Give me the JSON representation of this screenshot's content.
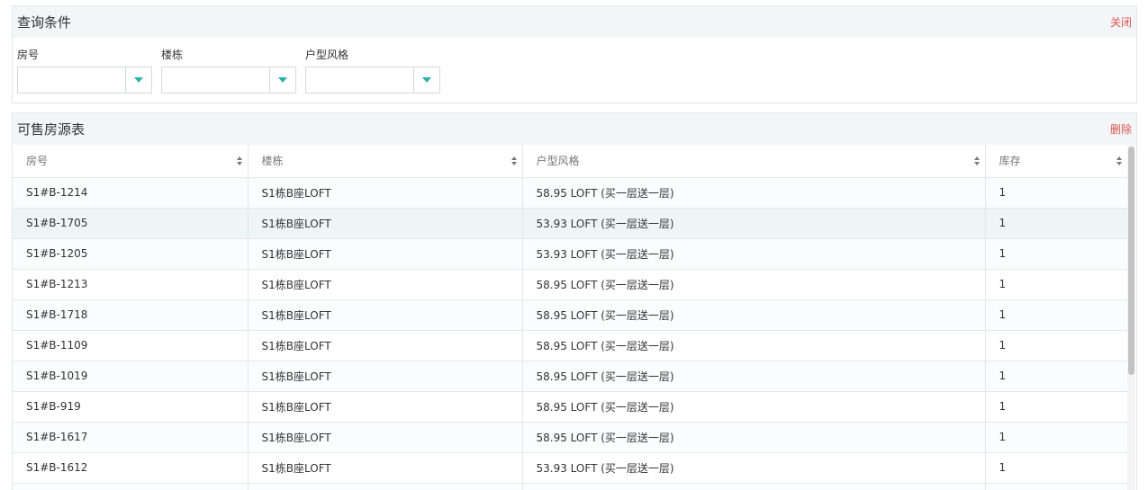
{
  "query": {
    "title": "查询条件",
    "close_label": "关闭",
    "filters": [
      {
        "label": "房号",
        "value": ""
      },
      {
        "label": "楼栋",
        "value": ""
      },
      {
        "label": "户型风格",
        "value": ""
      }
    ]
  },
  "listing": {
    "title": "可售房源表",
    "delete_label": "删除",
    "columns": [
      "房号",
      "楼栋",
      "户型风格",
      "库存"
    ],
    "rows": [
      [
        "S1#B-1214",
        "S1栋B座LOFT",
        "58.95 LOFT (买一层送一层)",
        "1"
      ],
      [
        "S1#B-1705",
        "S1栋B座LOFT",
        "53.93 LOFT (买一层送一层)",
        "1"
      ],
      [
        "S1#B-1205",
        "S1栋B座LOFT",
        "53.93 LOFT (买一层送一层)",
        "1"
      ],
      [
        "S1#B-1213",
        "S1栋B座LOFT",
        "58.95 LOFT (买一层送一层)",
        "1"
      ],
      [
        "S1#B-1718",
        "S1栋B座LOFT",
        "58.95 LOFT (买一层送一层)",
        "1"
      ],
      [
        "S1#B-1109",
        "S1栋B座LOFT",
        "58.95 LOFT (买一层送一层)",
        "1"
      ],
      [
        "S1#B-1019",
        "S1栋B座LOFT",
        "58.95 LOFT (买一层送一层)",
        "1"
      ],
      [
        "S1#B-919",
        "S1栋B座LOFT",
        "58.95 LOFT (买一层送一层)",
        "1"
      ],
      [
        "S1#B-1617",
        "S1栋B座LOFT",
        "58.95 LOFT (买一层送一层)",
        "1"
      ],
      [
        "S1#B-1612",
        "S1栋B座LOFT",
        "53.93 LOFT (买一层送一层)",
        "1"
      ],
      [
        "",
        "",
        "",
        ""
      ]
    ],
    "highlighted_row": 1
  },
  "colors": {
    "accent": "#2ab3a6",
    "danger": "#d9534f",
    "header_bg": "#f3f5f6"
  },
  "icons": {
    "dropdown": "caret-down-icon",
    "sort": "sort-icon"
  }
}
